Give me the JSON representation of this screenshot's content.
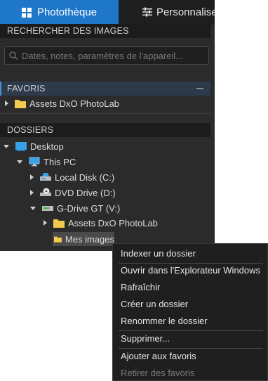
{
  "tabs": [
    {
      "label": "Photothèque",
      "icon": "grid-icon"
    },
    {
      "label": "Personnalise",
      "icon": "sliders-icon"
    }
  ],
  "sections": {
    "search": {
      "title": "RECHERCHER DES IMAGES",
      "placeholder": "Dates, notes, paramètres de l'appareil..."
    },
    "favorites": {
      "title": "FAVORIS",
      "items": [
        {
          "label": "Assets DxO PhotoLab"
        }
      ]
    },
    "folders": {
      "title": "DOSSIERS"
    }
  },
  "tree": [
    {
      "label": "Desktop",
      "icon": "desktop-icon",
      "state": "expanded"
    },
    {
      "label": "This PC",
      "icon": "monitor-icon",
      "state": "expanded"
    },
    {
      "label": "Local Disk (C:)",
      "icon": "disk-icon",
      "state": "collapsed"
    },
    {
      "label": "DVD Drive (D:)",
      "icon": "dvd-drive-icon",
      "state": "collapsed"
    },
    {
      "label": "G-Drive GT (V:)",
      "icon": "drive-icon",
      "state": "expanded"
    },
    {
      "label": "Assets DxO PhotoLab",
      "icon": "folder-icon",
      "state": "collapsed"
    },
    {
      "label": "Mes images",
      "icon": "folder-icon",
      "state": "selected"
    }
  ],
  "context_menu": {
    "items": [
      {
        "label": "Indexer un dossier",
        "enabled": true
      },
      {
        "label": "Ouvrir dans l'Explorateur Windows",
        "enabled": true
      },
      {
        "label": "Rafraîchir",
        "enabled": true
      },
      {
        "label": "Créer un dossier",
        "enabled": true
      },
      {
        "label": "Renommer le dossier",
        "enabled": true
      },
      {
        "label": "Supprimer...",
        "enabled": true
      },
      {
        "label": "Ajouter aux favoris",
        "enabled": true
      },
      {
        "label": "Retirer des favoris",
        "enabled": false
      }
    ]
  },
  "colors": {
    "accent": "#1f77c9",
    "panel_bg": "#2b2b2b",
    "folder": "#f2c94c",
    "menu_bg": "#1f1f1f"
  }
}
